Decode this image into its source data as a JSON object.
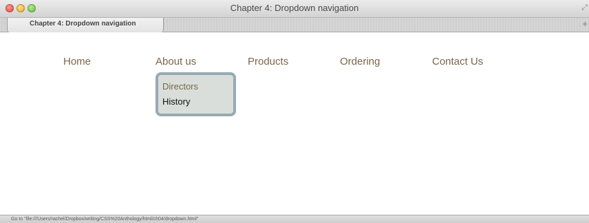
{
  "window": {
    "title": "Chapter 4: Dropdown navigation",
    "resize_icon": "⤢",
    "new_tab_icon": "+"
  },
  "tabs": [
    {
      "label": "Chapter 4: Dropdown navigation"
    }
  ],
  "nav": {
    "items": [
      {
        "label": "Home"
      },
      {
        "label": "About us"
      },
      {
        "label": "Products"
      },
      {
        "label": "Ordering"
      },
      {
        "label": "Contact Us"
      }
    ],
    "dropdown": {
      "items": [
        {
          "label": "Directors"
        },
        {
          "label": "History"
        }
      ]
    }
  },
  "statusbar": {
    "text": "Go to \"file:///Users/rachel/Dropbox/writing/CSS%20Anthology/html/ch04/dropdown.html\""
  },
  "colors": {
    "nav_text": "#7a6548",
    "dropdown_bg": "#d9dedb",
    "dropdown_border": "#96aab2",
    "hover_text": "#111111"
  }
}
